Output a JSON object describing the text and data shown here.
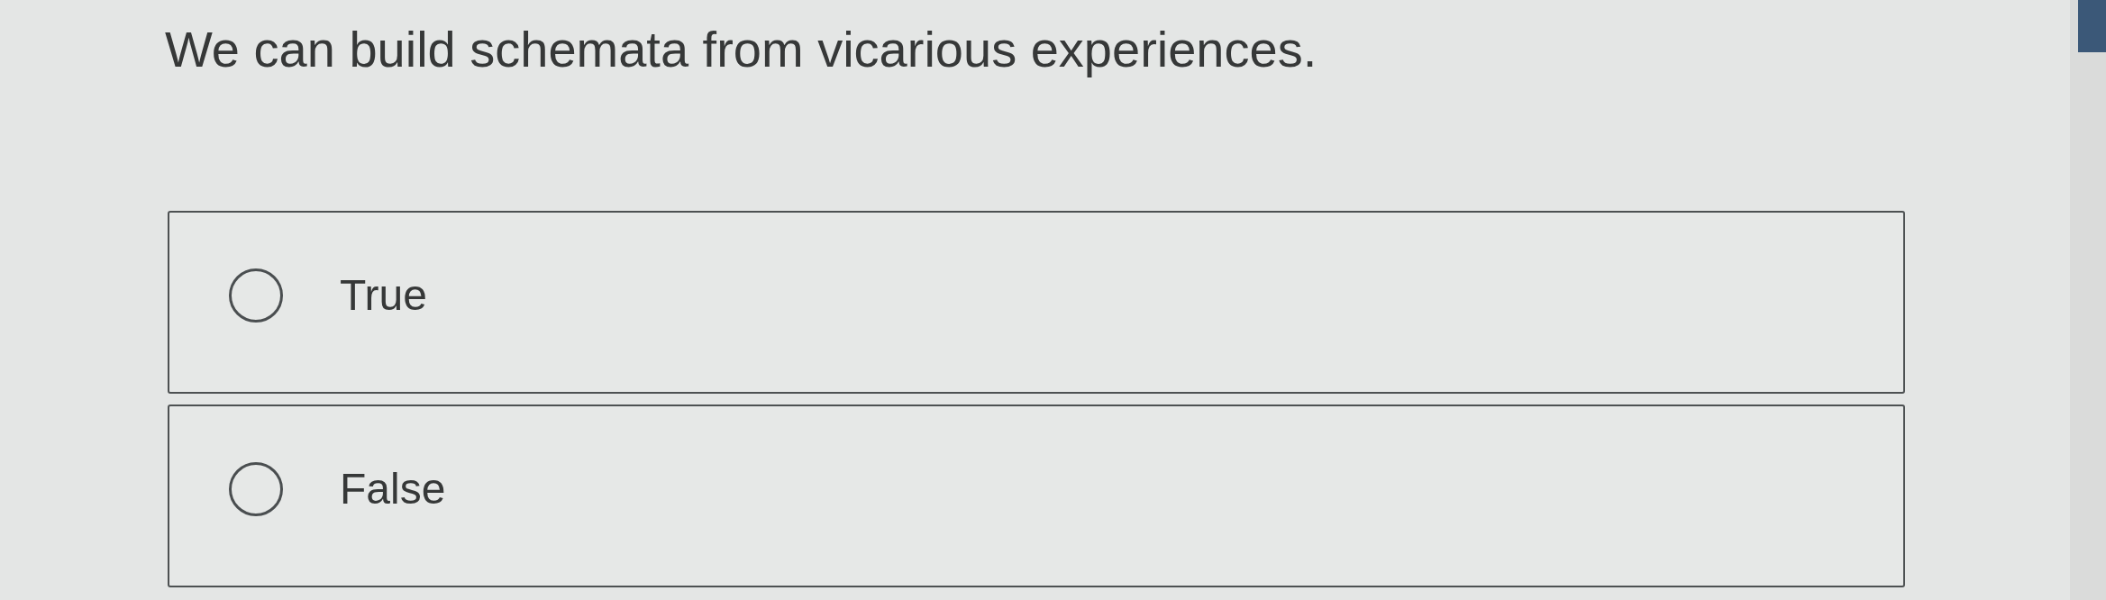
{
  "question": {
    "text": "We can build schemata from vicarious experiences."
  },
  "options": [
    {
      "label": "True",
      "selected": false
    },
    {
      "label": "False",
      "selected": false
    }
  ]
}
